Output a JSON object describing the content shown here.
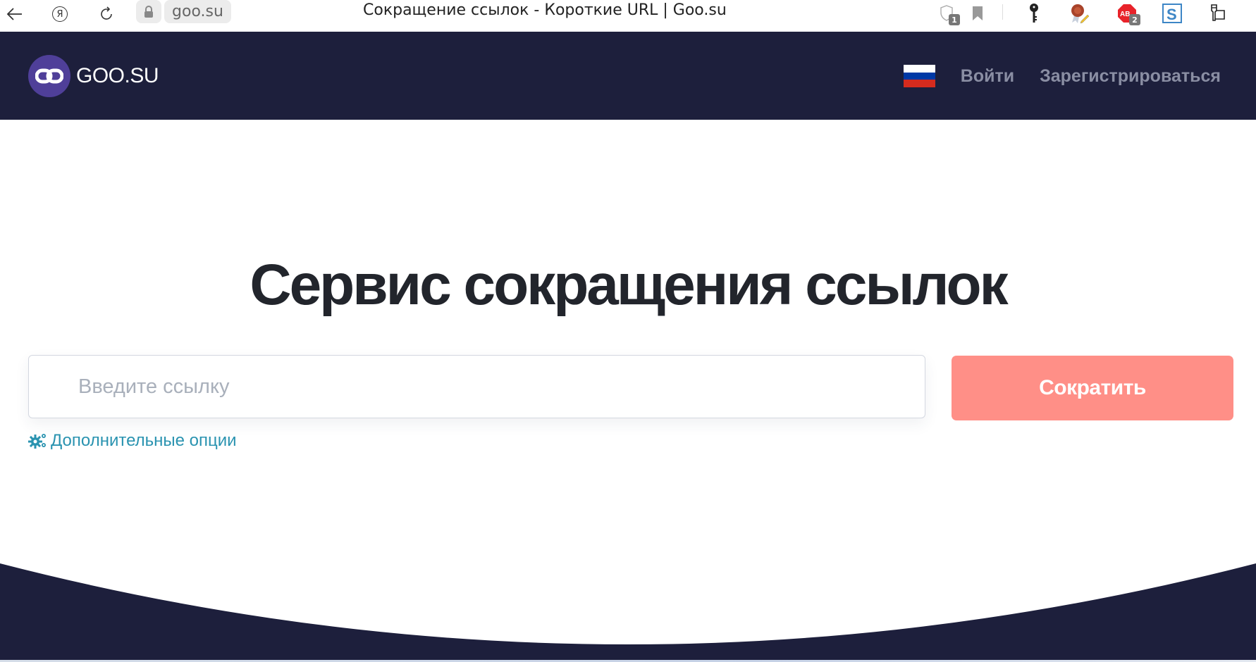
{
  "browser": {
    "url": "goo.su",
    "tab_title": "Сокращение ссылок - Короткие URL | Goo.su",
    "nav_icons": [
      "back-arrow-icon",
      "yandex-icon",
      "reload-icon",
      "lock-icon"
    ],
    "yandex_glyph": "Я",
    "extensions": [
      {
        "name": "shield-icon",
        "badge": "1"
      },
      {
        "name": "bookmark-icon"
      },
      {
        "name": "key-icon"
      },
      {
        "name": "seal-certificate-icon"
      },
      {
        "name": "adblock-icon",
        "badge": "2"
      },
      {
        "name": "s-extension-icon"
      },
      {
        "name": "extensions-puzzle-icon"
      }
    ]
  },
  "header": {
    "logo_text": "GOO.SU",
    "logo_icon": "chain-link-icon",
    "language_flag": "russia-flag",
    "login_label": "Войти",
    "register_label": "Зарегистрироваться"
  },
  "hero": {
    "title": "Сервис сокращения ссылок",
    "input_value": "",
    "input_placeholder": "Введите ссылку",
    "shorten_button_label": "Сократить",
    "options_icon": "gears-icon",
    "options_label": "Дополнительные опции"
  },
  "colors": {
    "header_bg": "#1d1f3c",
    "logo_circle": "#4f3f99",
    "nav_link": "#8a8ea3",
    "title_text": "#22252c",
    "button_bg": "#ff8f87",
    "options_link": "#2a93b0",
    "placeholder": "#a9b0bb",
    "flag_white": "#ffffff",
    "flag_blue": "#0039a6",
    "flag_red": "#d52b1e"
  }
}
